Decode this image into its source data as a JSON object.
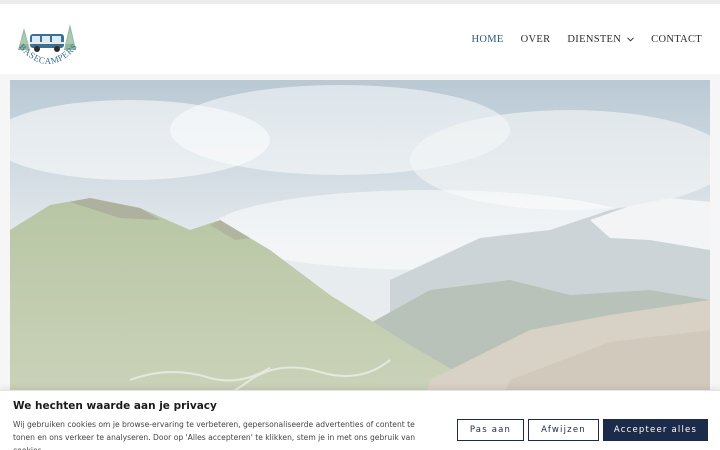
{
  "header": {
    "logo_text": "BASECAMPERS",
    "nav": {
      "home": "HOME",
      "over": "OVER",
      "diensten": "DIENSTEN",
      "contact": "CONTACT"
    }
  },
  "hero": {
    "image": "alpine-pass-serpentine-road"
  },
  "cookie": {
    "title": "We hechten waarde aan je privacy",
    "text": "Wij gebruiken cookies om je browse-ervaring te verbeteren, gepersonaliseerde advertenties of content te tonen en ons verkeer te analyseren. Door op 'Alles accepteren' te klikken, stem je in met ons gebruik van cookies.",
    "customize_label": "Pas aan",
    "reject_label": "Afwijzen",
    "accept_label": "Accepteer alles"
  },
  "colors": {
    "brand_navy": "#1d2b4a",
    "nav_active": "#2a5a7a"
  }
}
